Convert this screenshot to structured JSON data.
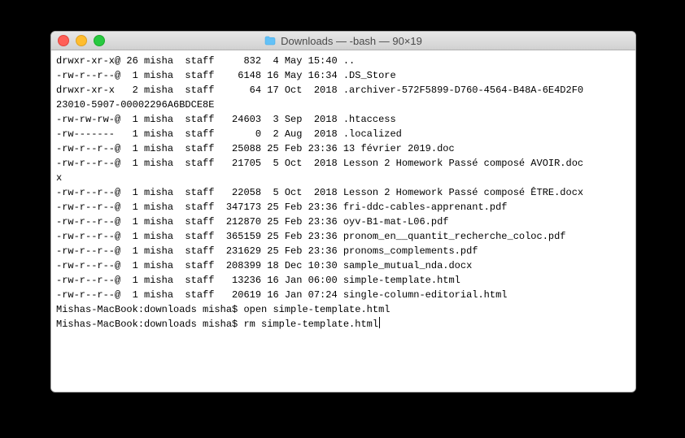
{
  "window": {
    "title": "Downloads — -bash — 90×19"
  },
  "listing": {
    "rows": [
      {
        "perms": "drwxr-xr-x@",
        "links": "26",
        "owner": "misha",
        "group": "staff",
        "size": "832",
        "date": " 4 May 15:40",
        "name": ".."
      },
      {
        "perms": "-rw-r--r--@",
        "links": " 1",
        "owner": "misha",
        "group": "staff",
        "size": "6148",
        "date": "16 May 16:34",
        "name": ".DS_Store"
      },
      {
        "perms": "drwxr-xr-x ",
        "links": " 2",
        "owner": "misha",
        "group": "staff",
        "size": "64",
        "date": "17 Oct  2018",
        "name": ".archiver-572F5899-D760-4564-B48A-6E4D2F0\n23010-5907-00002296A6BDCE8E"
      },
      {
        "perms": "-rw-rw-rw-@",
        "links": " 1",
        "owner": "misha",
        "group": "staff",
        "size": "24603",
        "date": " 3 Sep  2018",
        "name": ".htaccess"
      },
      {
        "perms": "-rw------- ",
        "links": " 1",
        "owner": "misha",
        "group": "staff",
        "size": "0",
        "date": " 2 Aug  2018",
        "name": ".localized"
      },
      {
        "perms": "-rw-r--r--@",
        "links": " 1",
        "owner": "misha",
        "group": "staff",
        "size": "25088",
        "date": "25 Feb 23:36",
        "name": "13 février 2019.doc"
      },
      {
        "perms": "-rw-r--r--@",
        "links": " 1",
        "owner": "misha",
        "group": "staff",
        "size": "21705",
        "date": " 5 Oct  2018",
        "name": "Lesson 2 Homework Passé composé AVOIR.doc\nx"
      },
      {
        "perms": "-rw-r--r--@",
        "links": " 1",
        "owner": "misha",
        "group": "staff",
        "size": "22058",
        "date": " 5 Oct  2018",
        "name": "Lesson 2 Homework Passé composé ÊTRE.docx"
      },
      {
        "perms": "-rw-r--r--@",
        "links": " 1",
        "owner": "misha",
        "group": "staff",
        "size": "347173",
        "date": "25 Feb 23:36",
        "name": "fri-ddc-cables-apprenant.pdf"
      },
      {
        "perms": "-rw-r--r--@",
        "links": " 1",
        "owner": "misha",
        "group": "staff",
        "size": "212870",
        "date": "25 Feb 23:36",
        "name": "oyv-B1-mat-L06.pdf"
      },
      {
        "perms": "-rw-r--r--@",
        "links": " 1",
        "owner": "misha",
        "group": "staff",
        "size": "365159",
        "date": "25 Feb 23:36",
        "name": "pronom_en__quantit_recherche_coloc.pdf"
      },
      {
        "perms": "-rw-r--r--@",
        "links": " 1",
        "owner": "misha",
        "group": "staff",
        "size": "231629",
        "date": "25 Feb 23:36",
        "name": "pronoms_complements.pdf"
      },
      {
        "perms": "-rw-r--r--@",
        "links": " 1",
        "owner": "misha",
        "group": "staff",
        "size": "208399",
        "date": "18 Dec 10:30",
        "name": "sample_mutual_nda.docx"
      },
      {
        "perms": "-rw-r--r--@",
        "links": " 1",
        "owner": "misha",
        "group": "staff",
        "size": "13236",
        "date": "16 Jan 06:00",
        "name": "simple-template.html"
      },
      {
        "perms": "-rw-r--r--@",
        "links": " 1",
        "owner": "misha",
        "group": "staff",
        "size": "20619",
        "date": "16 Jan 07:24",
        "name": "single-column-editorial.html"
      }
    ]
  },
  "prompts": [
    {
      "prompt": "Mishas-MacBook:downloads misha$ ",
      "command": "open simple-template.html"
    },
    {
      "prompt": "Mishas-MacBook:downloads misha$ ",
      "command": "rm simple-template.html"
    }
  ]
}
